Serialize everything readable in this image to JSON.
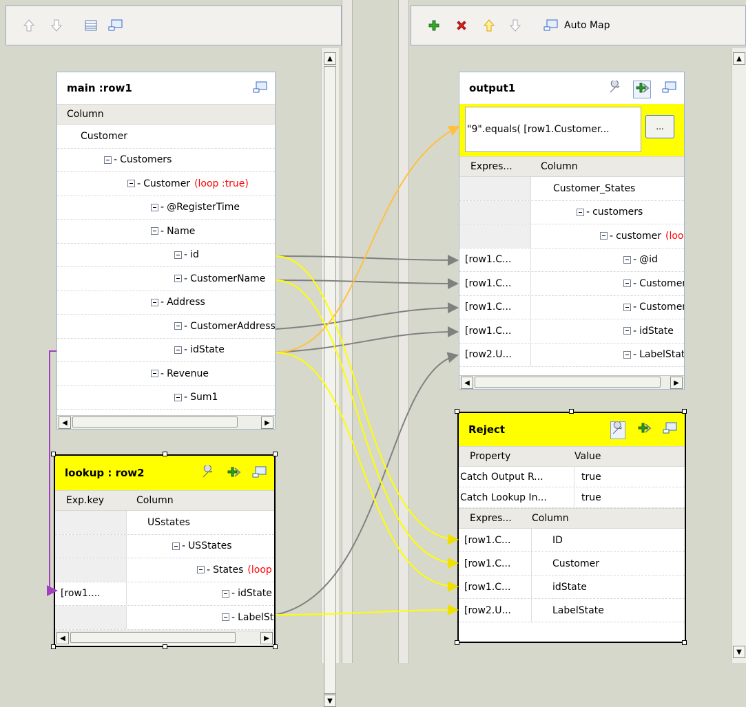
{
  "left_toolbar": {
    "icons": [
      "move-up-icon",
      "move-down-icon",
      "table-icon",
      "minimize-icon"
    ]
  },
  "right_toolbar": {
    "auto_map_label": "Auto Map"
  },
  "main_panel": {
    "title": "main :row1",
    "column_header": "Column",
    "tree": [
      {
        "label": "Customer",
        "level": 0,
        "expander": false
      },
      {
        "label": "Customers",
        "level": 1,
        "expander": true
      },
      {
        "label": "Customer",
        "level": 2,
        "expander": true,
        "loop": "(loop :true)"
      },
      {
        "label": "@RegisterTime",
        "level": 3,
        "expander": true
      },
      {
        "label": "Name",
        "level": 3,
        "expander": true
      },
      {
        "label": "id",
        "level": 4,
        "expander": true
      },
      {
        "label": "CustomerName",
        "level": 4,
        "expander": true
      },
      {
        "label": "Address",
        "level": 3,
        "expander": true
      },
      {
        "label": "CustomerAddress",
        "level": 4,
        "expander": true
      },
      {
        "label": "idState",
        "level": 4,
        "expander": true
      },
      {
        "label": "Revenue",
        "level": 3,
        "expander": true
      },
      {
        "label": "Sum1",
        "level": 4,
        "expander": true
      }
    ]
  },
  "lookup_panel": {
    "title": "lookup : row2",
    "exp_header": "Exp.key",
    "column_header": "Column",
    "rows": [
      {
        "exp": "",
        "label": "USstates",
        "level": 0,
        "expander": false
      },
      {
        "exp": "",
        "label": "USStates",
        "level": 1,
        "expander": true
      },
      {
        "exp": "",
        "label": "States",
        "level": 2,
        "expander": true,
        "loop": "(loop"
      },
      {
        "exp": "[row1....",
        "label": "idState",
        "level": 3,
        "expander": true
      },
      {
        "exp": "",
        "label": "LabelStat",
        "level": 3,
        "expander": true
      }
    ]
  },
  "output_panel": {
    "title": "output1",
    "filter_expression": "\"9\".equals( [row1.Customer...",
    "filter_button": "...",
    "exp_header": "Expres...",
    "column_header": "Column",
    "rows": [
      {
        "exp": "",
        "label": "Customer_States",
        "level": 0,
        "expander": false
      },
      {
        "exp": "",
        "label": "customers",
        "level": 1,
        "expander": true
      },
      {
        "exp": "",
        "label": "customer",
        "level": 2,
        "expander": true,
        "loop": "(loop"
      },
      {
        "exp": "[row1.C...",
        "label": "@id",
        "level": 3,
        "expander": true
      },
      {
        "exp": "[row1.C...",
        "label": "CustomerN",
        "level": 3,
        "expander": true
      },
      {
        "exp": "[row1.C...",
        "label": "CustomerA",
        "level": 3,
        "expander": true
      },
      {
        "exp": "[row1.C...",
        "label": "idState",
        "level": 3,
        "expander": true
      },
      {
        "exp": "[row2.U...",
        "label": "LabelState",
        "level": 3,
        "expander": true
      }
    ]
  },
  "reject_panel": {
    "title": "Reject",
    "property_header": "Property",
    "value_header": "Value",
    "properties": [
      {
        "name": "Catch Output R...",
        "value": "true"
      },
      {
        "name": "Catch Lookup In...",
        "value": "true"
      }
    ],
    "exp_header": "Expres...",
    "column_header": "Column",
    "rows": [
      {
        "exp": "[row1.C...",
        "label": "ID"
      },
      {
        "exp": "[row1.C...",
        "label": "Customer"
      },
      {
        "exp": "[row1.C...",
        "label": "idState"
      },
      {
        "exp": "[row2.U...",
        "label": "LabelState"
      }
    ]
  },
  "colors": {
    "gray_link": "#808080",
    "yellow_link": "#ffff00",
    "orange_link": "#ffc040",
    "purple_link": "#a040c0",
    "title_highlight": "#ffff00"
  }
}
